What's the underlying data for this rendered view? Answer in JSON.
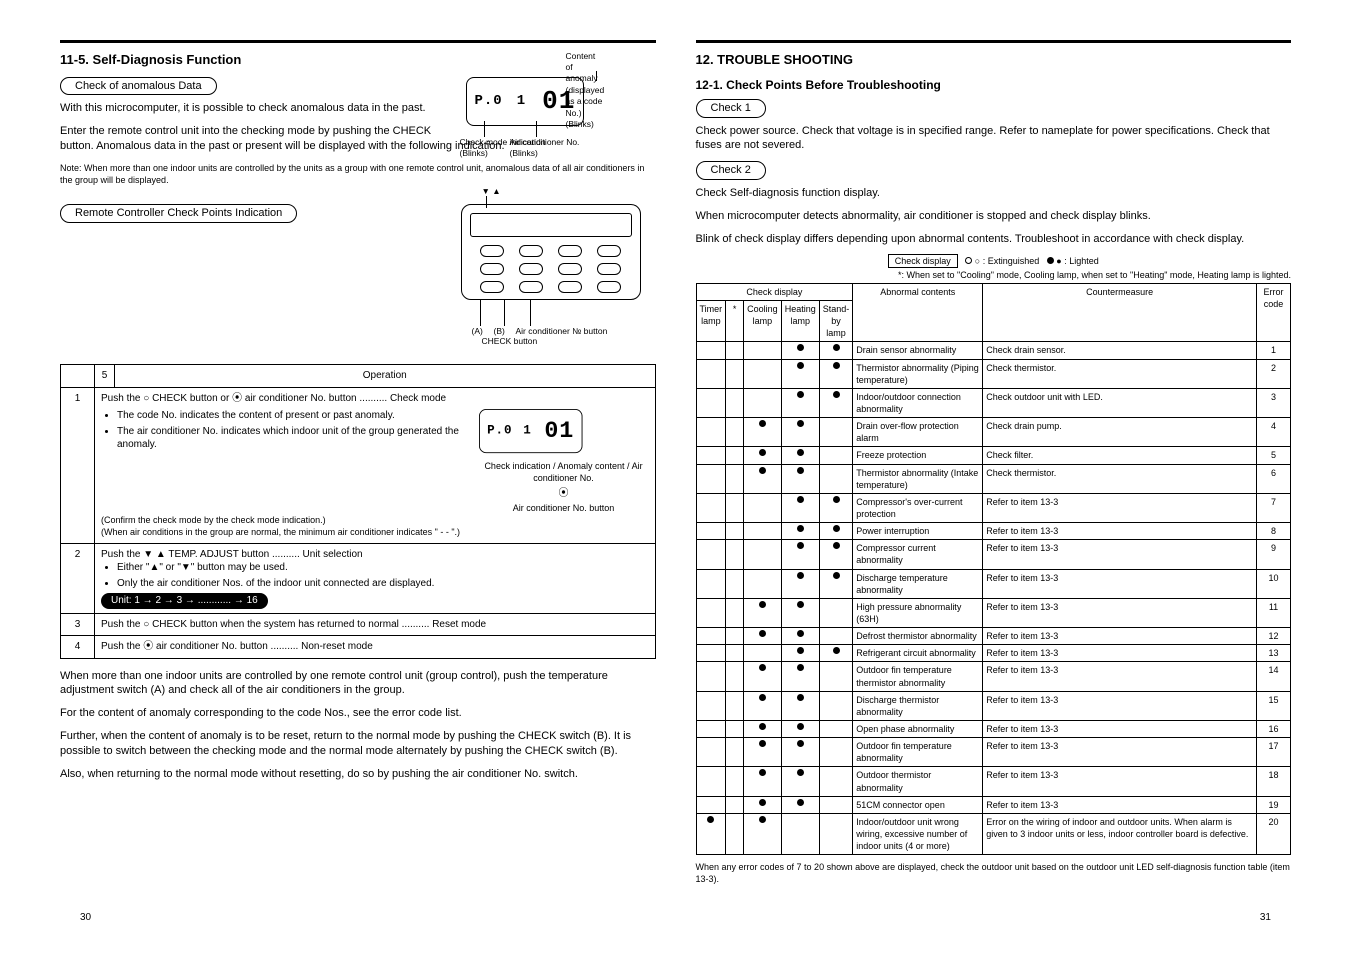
{
  "page_numbers": {
    "left": "30",
    "right": "31"
  },
  "left": {
    "title": "11-5. Self-Diagnosis Function",
    "sec1": {
      "pill": "Check of anomalous Data",
      "p1": "With this microcomputer, it is possible to check anomalous data in the past.",
      "p2": "Enter the remote control unit into the checking mode by pushing the CHECK button. Anomalous data in the past or present will be displayed with the following indication.",
      "callouts": {
        "checkmode": "Check mode indication",
        "checkmode_blink": "(Blinks)",
        "content": "Content of anomaly (displayed as a code No.)",
        "content_blink": "(Blinks)",
        "airno": "Air conditioner No.",
        "airno_blink": "(Blinks)"
      },
      "note": "Note: When more than one indoor units are controlled by the units as a group with one remote control unit, anomalous data of all air conditioners in the group will be displayed."
    },
    "sec2": {
      "pill": "Remote Controller Check Points Indication",
      "ctrl_labels": {
        "a": "(A)",
        "b": "(B)",
        "check": "CHECK button",
        "aircon": "Air conditioner № button"
      }
    },
    "steps": {
      "header": {
        "n": "",
        "5": "5",
        "op": "Operation"
      },
      "rows": [
        {
          "n": "1",
          "op_html": "Push the <span class='icon'>○</span> CHECK button or <span class='icon'>⦿</span> air conditioner No. button .......... Check mode",
          "notes": [
            "The code No. indicates the content of present or past anomaly.",
            "The air conditioner No. indicates which indoor unit of the group generated the anomaly.",
            "(Confirm the check mode by the check mode indication.)",
            "(When air conditions in the group are normal, the minimum air conditioner indicates \" - - \".)"
          ],
          "side_callouts": {
            "check_indication": "Check indication",
            "anomaly": "Anomaly content",
            "airno": "Air conditioner No."
          },
          "side_btn": "Air conditioner No. button"
        },
        {
          "n": "2",
          "op_html": "Push the <span class='icon'>▼</span> <span class='icon'>▲</span> TEMP. ADJUST button .......... Unit selection",
          "notes": [
            "Either \"▲\" or \"▼\" button may be used.",
            "Only the air conditioner Nos. of the indoor unit connected are displayed."
          ],
          "pill": "Unit: 1 → 2 → 3 → ............ → 16"
        },
        {
          "n": "3",
          "op_html": "Push the <span class='icon'>○</span> CHECK button when the system has returned to normal .......... Reset mode"
        },
        {
          "n": "4",
          "op_html": "Push the <span class='icon'>⦿</span> air conditioner No. button .......... Non-reset mode"
        }
      ]
    },
    "end": {
      "p1": "When more than one indoor units are controlled by one remote control unit (group control), push the temperature adjustment switch (A) and check all of the air conditioners in the group.",
      "p2": "For the content of anomaly corresponding to the code Nos., see the error code list.",
      "p3": "Further, when the content of anomaly is to be reset, return to the normal mode by pushing the CHECK switch (B). It is possible to switch between the checking mode and the normal mode alternately by pushing the CHECK switch (B).",
      "p4": "Also, when returning to the normal mode without resetting, do so by pushing the air conditioner No. switch."
    }
  },
  "right": {
    "title": "12. TROUBLE SHOOTING",
    "subtitle": "12-1. Check Points Before Troubleshooting",
    "check1": {
      "pill": "Check 1",
      "text": "Check power source. Check that voltage is in specified range. Refer to nameplate for power specifications. Check that fuses are not severed."
    },
    "check2": {
      "pill": "Check 2",
      "text_lines": [
        "Check Self-diagnosis function display.",
        "When microcomputer detects abnormality, air conditioner is stopped and check display blinks.",
        "Blink of check display differs depending upon abnormal contents. Troubleshoot in accordance with check display."
      ]
    },
    "legend": {
      "label": "Check display",
      "off": "○ : Extinguished",
      "on": "● : Lighted"
    },
    "mode_note": "*: When set to \"Cooling\" mode, Cooling lamp, when set to \"Heating\" mode, Heating lamp is lighted.",
    "table": {
      "headers": {
        "check": "Check display",
        "timer": "Timer lamp",
        "cool": "Cooling lamp",
        "heat": "Heating lamp",
        "standby": "Stand-by lamp",
        "contents": "Abnormal contents",
        "counter": "Countermeasure",
        "index": "Error code"
      },
      "rows": [
        {
          "t": "",
          "c": "",
          "h": "●",
          "s": "●",
          "contents": "Drain sensor abnormality",
          "counter": "Check drain sensor.",
          "idx": "1"
        },
        {
          "t": "",
          "c": "",
          "h": "●",
          "s": "●",
          "contents": "Thermistor abnormality (Piping temperature)",
          "counter": "Check thermistor.",
          "idx": "2"
        },
        {
          "t": "",
          "c": "",
          "h": "●",
          "s": "●",
          "contents": "Indoor/outdoor connection abnormality",
          "counter": "Check outdoor unit with LED.",
          "idx": "3"
        },
        {
          "t": "",
          "c": "●",
          "h": "●",
          "s": "",
          "contents": "Drain over-flow protection alarm",
          "counter": "Check drain pump.",
          "idx": "4"
        },
        {
          "t": "",
          "c": "●",
          "h": "●",
          "s": "",
          "contents": "Freeze protection",
          "counter": "Check filter.",
          "idx": "5"
        },
        {
          "t": "",
          "c": "●",
          "h": "●",
          "s": "",
          "contents": "Thermistor abnormality (Intake temperature)",
          "counter": "Check thermistor.",
          "idx": "6"
        },
        {
          "t": "",
          "c": "",
          "h": "●",
          "s": "●",
          "contents": "Compressor's over-current protection",
          "counter": "Refer to item 13-3",
          "idx": "7"
        },
        {
          "t": "",
          "c": "",
          "h": "●",
          "s": "●",
          "contents": "Power interruption",
          "counter": "Refer to item 13-3",
          "idx": "8"
        },
        {
          "t": "",
          "c": "",
          "h": "●",
          "s": "●",
          "contents": "Compressor current abnormality",
          "counter": "Refer to item 13-3",
          "idx": "9"
        },
        {
          "t": "",
          "c": "",
          "h": "●",
          "s": "●",
          "contents": "Discharge temperature abnormality",
          "counter": "Refer to item 13-3",
          "idx": "10"
        },
        {
          "t": "",
          "c": "●",
          "h": "●",
          "s": "",
          "contents": "High pressure abnormality (63H)",
          "counter": "Refer to item 13-3",
          "idx": "11"
        },
        {
          "t": "",
          "c": "●",
          "h": "●",
          "s": "",
          "contents": "Defrost thermistor abnormality",
          "counter": "Refer to item 13-3",
          "idx": "12"
        },
        {
          "t": "",
          "c": "",
          "h": "●",
          "s": "",
          "star_s": "●",
          "contents": "Refrigerant circuit abnormality",
          "counter": "Refer to item 13-3",
          "idx": "13"
        },
        {
          "t": "",
          "c": "●",
          "h": "●",
          "s": "",
          "contents": "Outdoor fin temperature thermistor abnormality",
          "counter": "Refer to item 13-3",
          "idx": "14"
        },
        {
          "t": "",
          "c": "●",
          "h": "●",
          "s": "",
          "contents": "Discharge thermistor abnormality",
          "counter": "Refer to item 13-3",
          "idx": "15"
        },
        {
          "t": "",
          "c": "●",
          "h": "●",
          "s": "",
          "contents": "Open phase abnormality",
          "counter": "Refer to item 13-3",
          "idx": "16"
        },
        {
          "t": "",
          "c": "●",
          "h": "●",
          "s": "",
          "contents": "Outdoor fin temperature abnormality",
          "counter": "Refer to item 13-3",
          "idx": "17"
        },
        {
          "t": "",
          "c": "●",
          "h": "●",
          "s": "",
          "contents": "Outdoor thermistor abnormality",
          "counter": "Refer to item 13-3",
          "idx": "18"
        },
        {
          "t": "",
          "c": "●",
          "h": "●",
          "s": "",
          "contents": "51CM connector open",
          "counter": "Refer to item 13-3",
          "idx": "19"
        },
        {
          "t": "●",
          "c": "●",
          "h": "",
          "s": "",
          "contents": "Indoor/outdoor unit wrong wiring, excessive number of indoor units (4 or more)",
          "counter": "Error on the wiring of indoor and outdoor units. When alarm is given to 3 indoor units or less, indoor controller board is defective.",
          "idx": "20"
        }
      ]
    },
    "footnote": "When any error codes of 7 to 20 shown above are displayed, check the outdoor unit based on the outdoor unit LED self-diagnosis function table (item 13-3)."
  }
}
